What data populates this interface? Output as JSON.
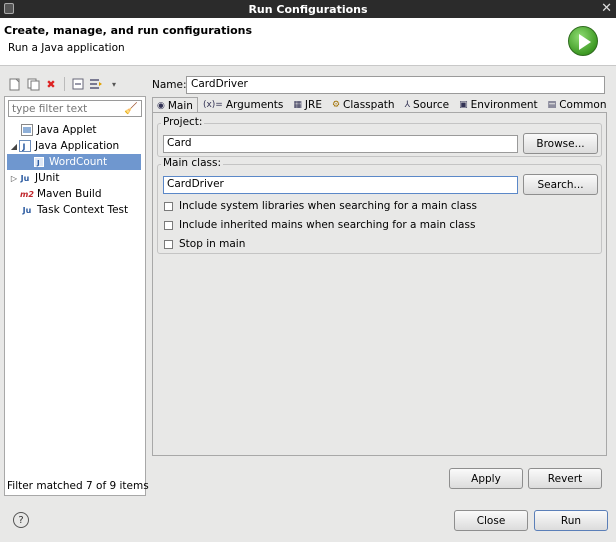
{
  "window": {
    "title": "Run Configurations"
  },
  "header": {
    "title": "Create, manage, and run configurations",
    "subtitle": "Run a Java application"
  },
  "left": {
    "filter_placeholder": "type filter text",
    "tree": [
      {
        "label": "Java Applet",
        "icon": "java-applet-icon",
        "indent": 1
      },
      {
        "label": "Java Application",
        "icon": "java-application-icon",
        "indent": 0,
        "expanded": true
      },
      {
        "label": "WordCount",
        "icon": "java-class-icon",
        "indent": 2,
        "selected": true
      },
      {
        "label": "JUnit",
        "icon": "junit-icon",
        "indent": 0,
        "expanded": false
      },
      {
        "label": "Maven Build",
        "icon": "maven-icon",
        "indent": 1
      },
      {
        "label": "Task Context Test",
        "icon": "task-context-icon",
        "indent": 1
      }
    ],
    "status": "Filter matched 7 of 9 items"
  },
  "config": {
    "name_label": "Name:",
    "name_value": "CardDriver",
    "tabs": [
      "Main",
      "Arguments",
      "JRE",
      "Classpath",
      "Source",
      "Environment",
      "Common"
    ],
    "active_tab": "Main",
    "project_label": "Project:",
    "project_value": "Card",
    "browse_label": "Browse...",
    "main_class_label": "Main class:",
    "main_class_value": "CardDriver",
    "search_label": "Search...",
    "checkboxes": [
      {
        "label": "Include system libraries when searching for a main class",
        "checked": false
      },
      {
        "label": "Include inherited mains when searching for a main class",
        "checked": false
      },
      {
        "label": "Stop in main",
        "checked": false
      }
    ],
    "apply_label": "Apply",
    "revert_label": "Revert"
  },
  "footer": {
    "close_label": "Close",
    "run_label": "Run"
  }
}
